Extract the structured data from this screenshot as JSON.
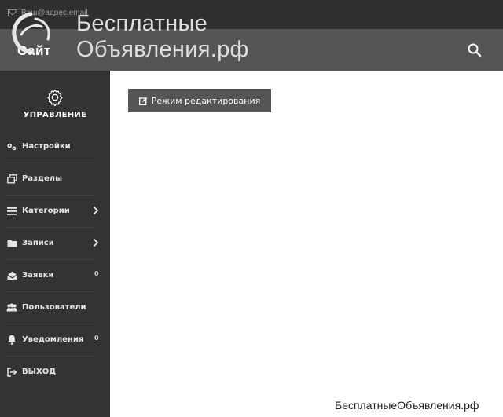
{
  "header": {
    "email": "Ваш@адрес.email",
    "site_label": "Сайт",
    "watermark_line1": "Бесплатные",
    "watermark_line2": "Объявления.рф",
    "search_icon": "search-icon"
  },
  "sidebar": {
    "management_label": "УПРАВЛЕНИЕ",
    "management_icon": "gear-icon",
    "items": [
      {
        "label": "Настройки",
        "icon": "gears-icon"
      },
      {
        "label": "Разделы",
        "icon": "windows-icon"
      },
      {
        "label": "Категории",
        "icon": "list-icon",
        "chevron": true
      },
      {
        "label": "Записи",
        "icon": "folder-icon",
        "chevron": true
      },
      {
        "label": "Заявки",
        "icon": "open-envelope-icon",
        "count": "0"
      },
      {
        "label": "Пользователи",
        "icon": "users-icon"
      },
      {
        "label": "Уведомления",
        "icon": "bell-icon",
        "count": "0"
      },
      {
        "label": "ВЫХОД",
        "icon": "sign-out-icon"
      }
    ]
  },
  "content": {
    "edit_button_label": "Режим редактирования",
    "edit_button_icon": "edit-icon"
  },
  "footer": {
    "watermark": "БесплатныеОбъявления.рф"
  },
  "colors": {
    "topbar": "#2f2f2f",
    "header": "#555555",
    "sidebar": "#333333",
    "button": "#555555",
    "content_bg": "#ffffff"
  }
}
